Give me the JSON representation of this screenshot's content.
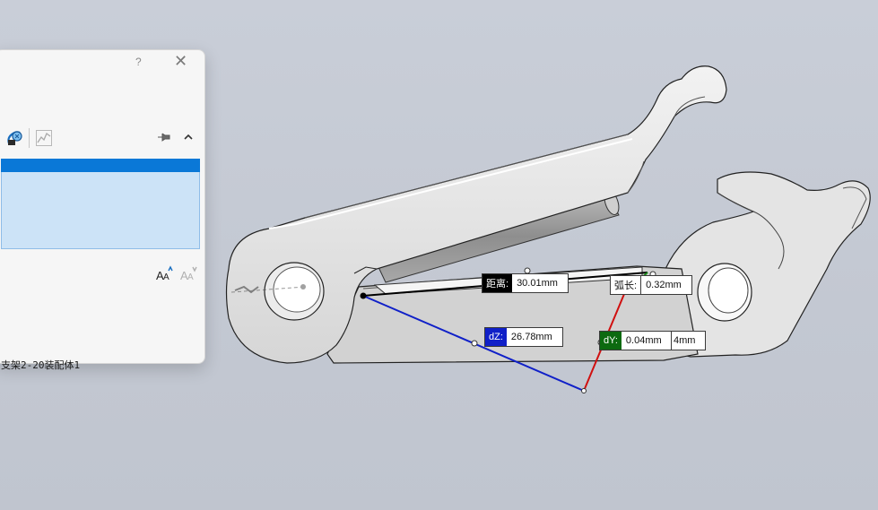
{
  "panel": {
    "help_label": "?",
    "close_label": "✕",
    "selection_item": "支架2-20装配体1"
  },
  "measurements": {
    "distance": {
      "tag": "距离:",
      "value": "30.01mm"
    },
    "arc_length": {
      "tag": "弧长:",
      "value": "0.32mm"
    },
    "dz": {
      "tag": "dZ:",
      "value": "26.78mm"
    },
    "dy": {
      "tag": "dY:",
      "value": "0.04mm"
    },
    "dx_partial": {
      "value": "4mm"
    }
  },
  "colors": {
    "viewport_bg": "#c5cad4",
    "part_fill": "#dcdcdc",
    "dz_line": "#1020c8",
    "dy_line": "#d01010",
    "selection_highlight": "#0a78d7"
  }
}
